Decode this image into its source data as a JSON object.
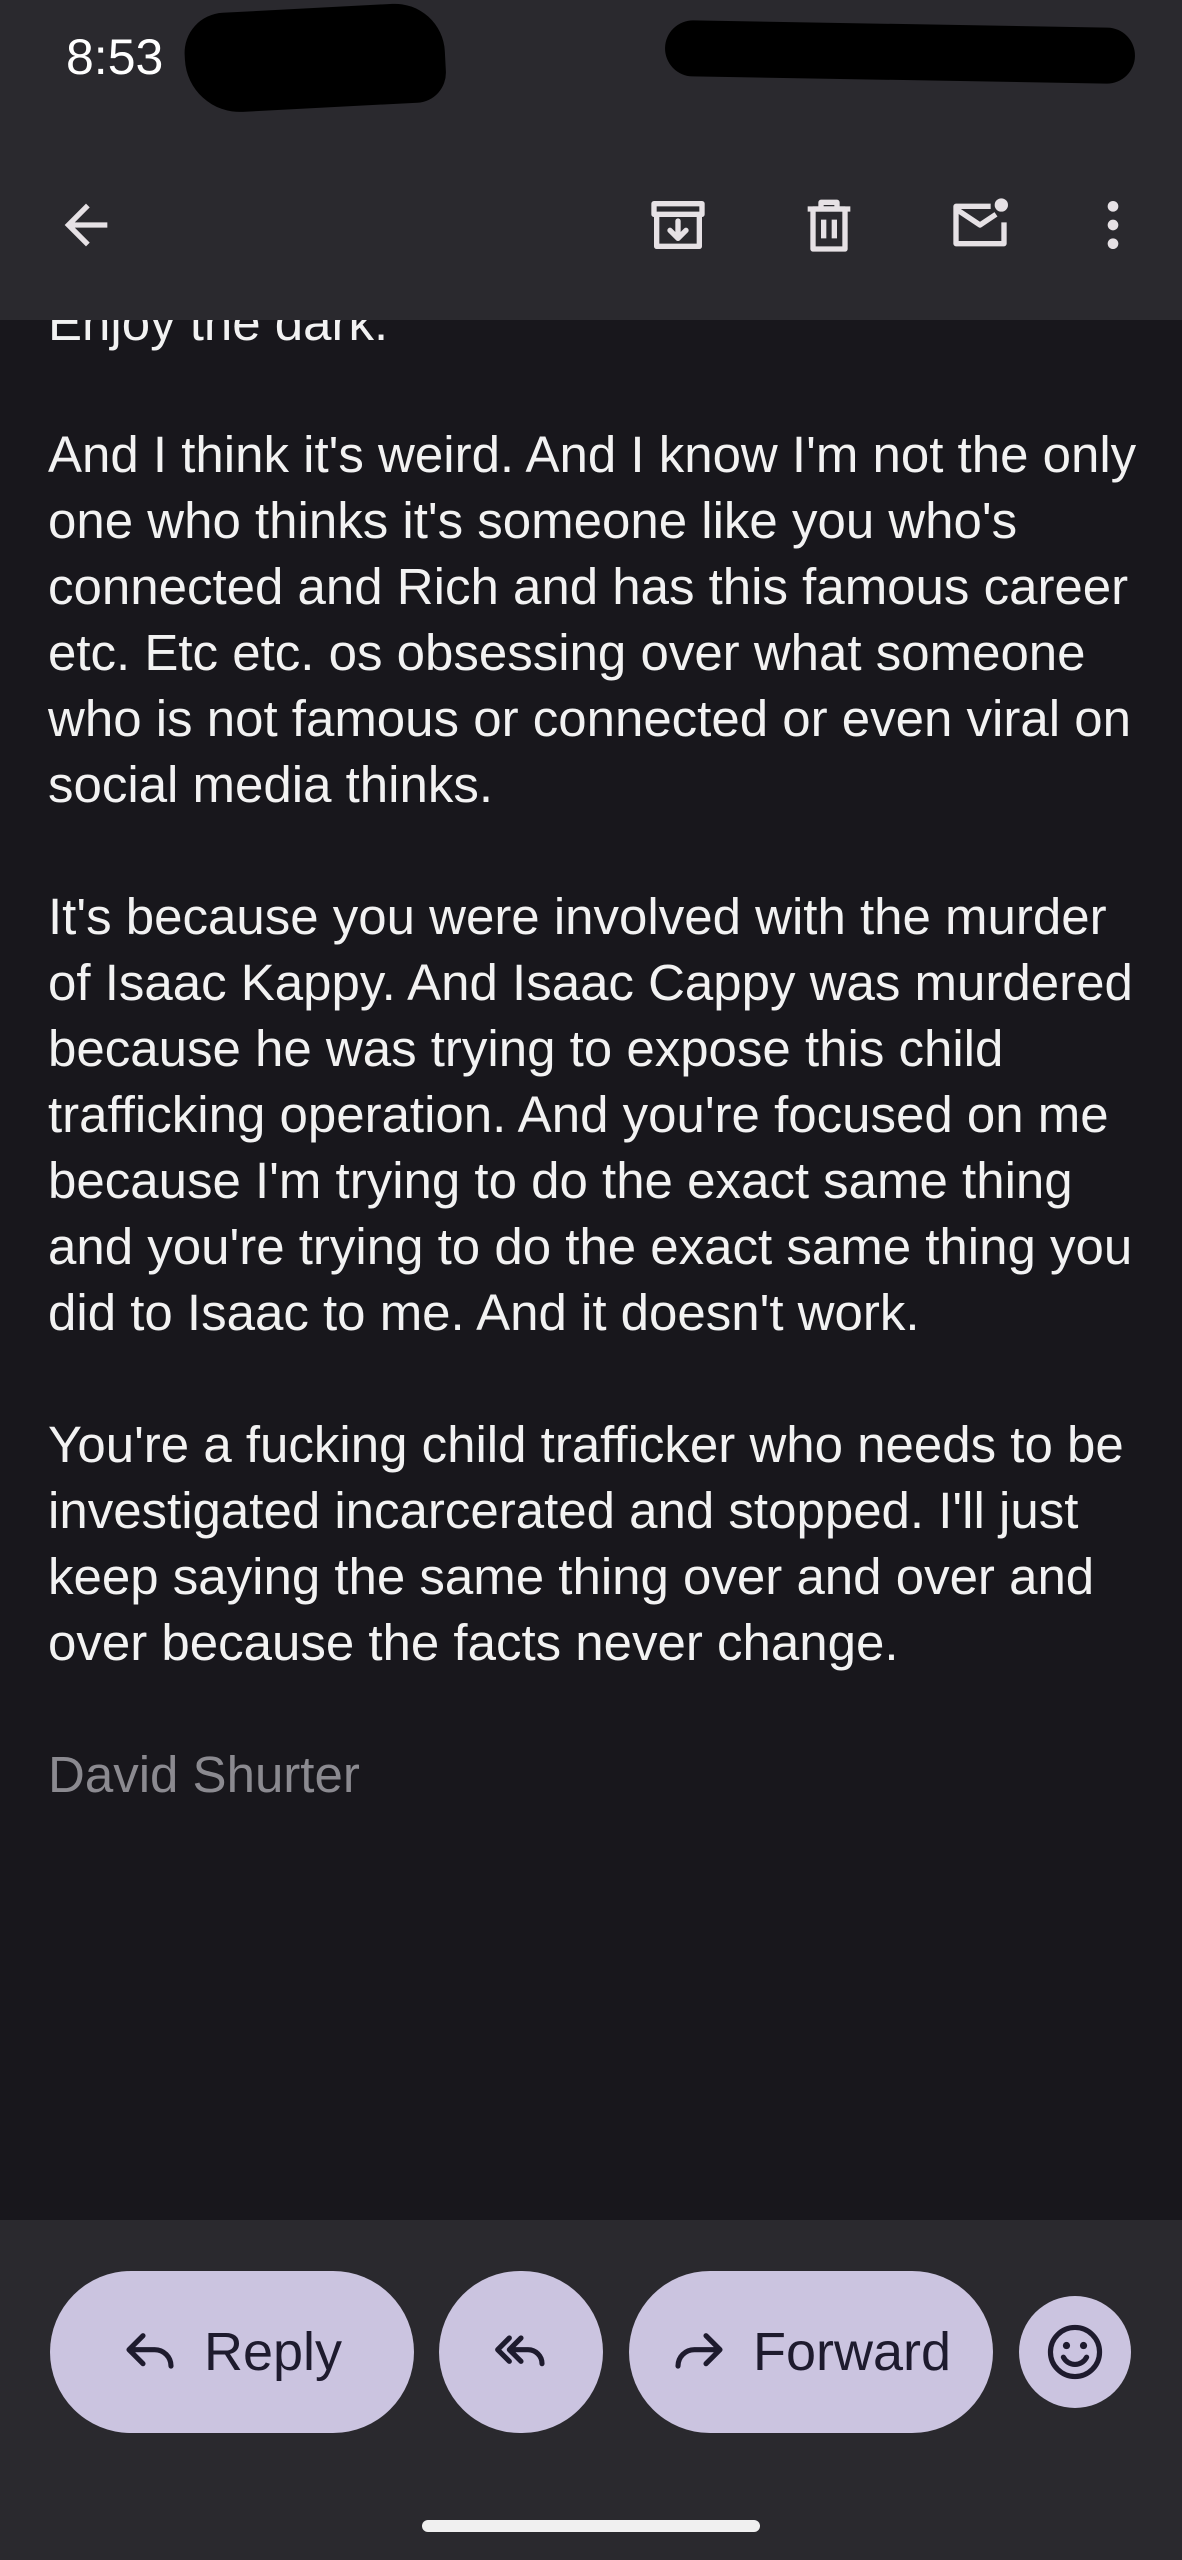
{
  "status_bar": {
    "time": "8:53"
  },
  "toolbar": {
    "back_icon": "arrow-left-icon",
    "archive_icon": "archive-icon",
    "delete_icon": "trash-icon",
    "mark_unread_icon": "mail-unread-icon",
    "more_icon": "more-vert-icon"
  },
  "message": {
    "cut_line": "Enjoy the dark.",
    "paragraphs": [
      "And I think it's weird. And I know I'm not the only one who thinks it's someone like you who's connected and Rich and has this famous career etc. Etc etc. os obsessing over what someone who is not famous or connected or even viral on social media thinks.",
      "It's because you were involved with the murder of Isaac Kappy. And Isaac Cappy was murdered because he was trying to expose this child trafficking operation. And you're focused on me because I'm trying to do the exact same thing and you're trying to do the exact same thing you did to Isaac to me. And it doesn't work.",
      "You're a fucking child trafficker who needs to be investigated incarcerated and stopped. I'll just keep saying the same thing over and over and over because the facts never change."
    ],
    "signature": "David Shurter"
  },
  "actions": {
    "reply_label": "Reply",
    "forward_label": "Forward",
    "reply_all_icon": "reply-all-icon",
    "emoji_icon": "emoji-icon"
  },
  "colors": {
    "background": "#18171c",
    "bars": "#2a292e",
    "pill": "#cbc4e0"
  }
}
